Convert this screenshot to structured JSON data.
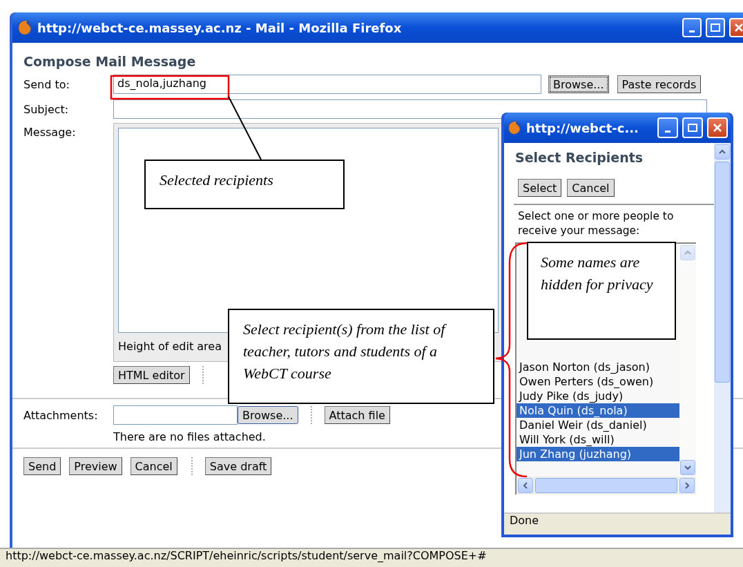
{
  "window": {
    "title": "http://webct-ce.massey.ac.nz - Mail - Mozilla Firefox"
  },
  "compose": {
    "heading": "Compose Mail Message",
    "send_to": {
      "label": "Send to:",
      "value": "ds_nola,juzhang",
      "buttons": [
        "Browse...",
        "Paste records"
      ]
    },
    "subject": {
      "label": "Subject:"
    },
    "message": {
      "label": "Message:",
      "height_label": "Height of edit area",
      "editor_button": "HTML editor"
    },
    "attachments": {
      "label": "Attachments:",
      "buttons": [
        "Browse...",
        "Attach file"
      ],
      "note": "There are no files attached."
    },
    "actions": [
      "Send",
      "Preview",
      "Cancel"
    ],
    "draft_button": "Save draft"
  },
  "popup": {
    "title": "http://webct-c...",
    "heading": "Select Recipients",
    "buttons": [
      "Select",
      "Cancel"
    ],
    "instructions": "Select one or more people to receive your message:",
    "people": [
      {
        "name": "Jason Norton (ds_jason)",
        "selected": false
      },
      {
        "name": "Owen Perters (ds_owen)",
        "selected": false
      },
      {
        "name": "Judy Pike (ds_judy)",
        "selected": false
      },
      {
        "name": "Nola Quin (ds_nola)",
        "selected": true
      },
      {
        "name": "Daniel Weir (ds_daniel)",
        "selected": false
      },
      {
        "name": "Will York (ds_will)",
        "selected": false
      },
      {
        "name": "Jun Zhang (juzhang)",
        "selected": true
      }
    ],
    "status": "Done"
  },
  "callouts": [
    "Selected recipients",
    "Select recipient(s) from the list of teacher, tutors and students of a WebCT course",
    "Some names are hidden for privacy"
  ],
  "status_bar": "http://webct-ce.massey.ac.nz/SCRIPT/eheinric/scripts/student/serve_mail?COMPOSE+#"
}
